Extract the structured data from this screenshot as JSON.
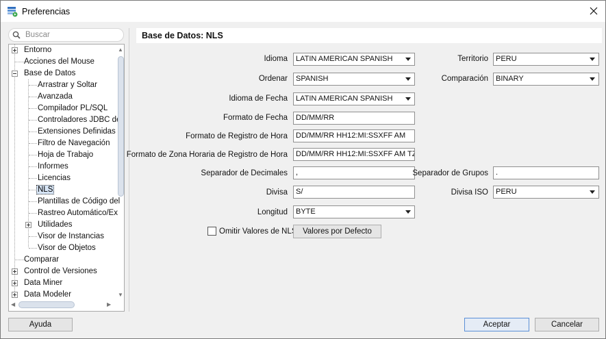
{
  "window": {
    "title": "Preferencias"
  },
  "search": {
    "placeholder": "Buscar"
  },
  "tree": {
    "items": [
      {
        "label": "Entorno"
      },
      {
        "label": "Acciones del Mouse"
      },
      {
        "label": "Base de Datos"
      },
      {
        "label": "Arrastrar y Soltar"
      },
      {
        "label": "Avanzada"
      },
      {
        "label": "Compilador PL/SQL"
      },
      {
        "label": "Controladores JDBC de"
      },
      {
        "label": "Extensiones Definidas p"
      },
      {
        "label": "Filtro de Navegación"
      },
      {
        "label": "Hoja de Trabajo"
      },
      {
        "label": "Informes"
      },
      {
        "label": "Licencias"
      },
      {
        "label": "NLS"
      },
      {
        "label": "Plantillas de Código del"
      },
      {
        "label": "Rastreo Automático/Ex"
      },
      {
        "label": "Utilidades"
      },
      {
        "label": "Visor de Instancias"
      },
      {
        "label": "Visor de Objetos"
      },
      {
        "label": "Comparar"
      },
      {
        "label": "Control de Versiones"
      },
      {
        "label": "Data Miner"
      },
      {
        "label": "Data Modeler"
      }
    ]
  },
  "panel": {
    "title": "Base de Datos: NLS",
    "idioma_label": "Idioma",
    "idioma_value": "LATIN AMERICAN SPANISH",
    "territorio_label": "Territorio",
    "territorio_value": "PERU",
    "ordenar_label": "Ordenar",
    "ordenar_value": "SPANISH",
    "comparacion_label": "Comparación",
    "comparacion_value": "BINARY",
    "idioma_fecha_label": "Idioma de Fecha",
    "idioma_fecha_value": "LATIN AMERICAN SPANISH",
    "formato_fecha_label": "Formato de Fecha",
    "formato_fecha_value": "DD/MM/RR",
    "formato_hora_label": "Formato de Registro de Hora",
    "formato_hora_value": "DD/MM/RR HH12:MI:SSXFF AM",
    "formato_zona_label": "Formato de Zona Horaria de Registro de Hora",
    "formato_zona_value": "DD/MM/RR HH12:MI:SSXFF AM TZR",
    "sep_decimales_label": "Separador de Decimales",
    "sep_decimales_value": ",",
    "sep_grupos_label": "Separador de Grupos",
    "sep_grupos_value": ".",
    "divisa_label": "Divisa",
    "divisa_value": "S/",
    "divisa_iso_label": "Divisa ISO",
    "divisa_iso_value": "PERU",
    "longitud_label": "Longitud",
    "longitud_value": "BYTE",
    "omitir_label": "Omitir Valores de NLS",
    "defaults_button": "Valores por Defecto"
  },
  "footer": {
    "help_button": "Ayuda",
    "accept_button": "Aceptar",
    "cancel_button": "Cancelar"
  },
  "colors": {
    "accent": "#5a8fd6",
    "selection": "#d6e4f5"
  }
}
